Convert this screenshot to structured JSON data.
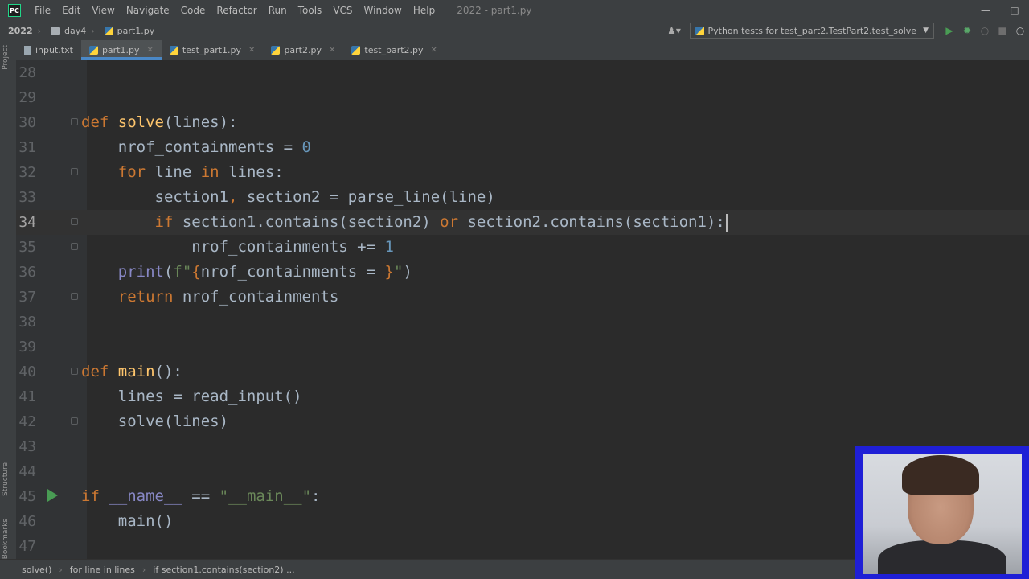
{
  "menu": {
    "items": [
      "File",
      "Edit",
      "View",
      "Navigate",
      "Code",
      "Refactor",
      "Run",
      "Tools",
      "VCS",
      "Window",
      "Help"
    ],
    "window_title": "2022 - part1.py"
  },
  "nav": {
    "project": "2022",
    "folder": "day4",
    "file": "part1.py",
    "run_config": "Python tests for test_part2.TestPart2.test_solve"
  },
  "side_labels": {
    "project": "Project",
    "structure": "Structure",
    "bookmarks": "Bookmarks"
  },
  "tabs": [
    {
      "label": "input.txt",
      "type": "txt"
    },
    {
      "label": "part1.py",
      "type": "py",
      "active": true
    },
    {
      "label": "test_part1.py",
      "type": "py"
    },
    {
      "label": "part2.py",
      "type": "py"
    },
    {
      "label": "test_part2.py",
      "type": "py"
    }
  ],
  "editor": {
    "lines": [
      {
        "n": "28",
        "code": ""
      },
      {
        "n": "29",
        "code": ""
      },
      {
        "n": "30",
        "code": "def solve(lines):"
      },
      {
        "n": "31",
        "code": "    nrof_containments = 0"
      },
      {
        "n": "32",
        "code": "    for line in lines:"
      },
      {
        "n": "33",
        "code": "        section1, section2 = parse_line(line)"
      },
      {
        "n": "34",
        "code": "        if section1.contains(section2) or section2.contains(section1):"
      },
      {
        "n": "35",
        "code": "            nrof_containments += 1"
      },
      {
        "n": "36",
        "code": "    print(f\"{nrof_containments = }\")"
      },
      {
        "n": "37",
        "code": "    return nrof_containments"
      },
      {
        "n": "38",
        "code": ""
      },
      {
        "n": "39",
        "code": ""
      },
      {
        "n": "40",
        "code": "def main():"
      },
      {
        "n": "41",
        "code": "    lines = read_input()"
      },
      {
        "n": "42",
        "code": "    solve(lines)"
      },
      {
        "n": "43",
        "code": ""
      },
      {
        "n": "44",
        "code": ""
      },
      {
        "n": "45",
        "code": "if __name__ == \"__main__\":"
      },
      {
        "n": "46",
        "code": "    main()"
      },
      {
        "n": "47",
        "code": ""
      }
    ],
    "current_line": "34"
  },
  "statusbar": {
    "breadcrumbs": [
      "solve()",
      "for line in lines",
      "if section1.contains(section2) ..."
    ]
  },
  "colors": {
    "keyword": "#cc7832",
    "function": "#ffc66d",
    "number": "#6897bb",
    "string": "#6a8759",
    "builtin": "#8888c6",
    "webcam_border": "#1f1fd6"
  }
}
